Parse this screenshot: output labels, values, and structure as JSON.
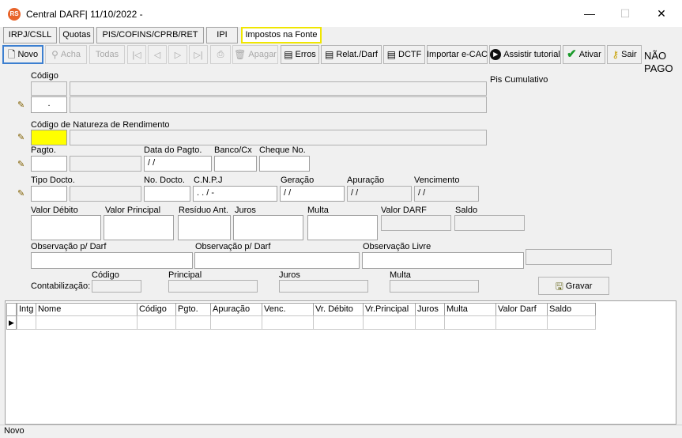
{
  "window": {
    "title": "Central DARF| 11/10/2022 -",
    "app_icon": "RS",
    "minimize": "—",
    "maximize": "☐",
    "close": "✕"
  },
  "tabs": [
    {
      "label": "IRPJ/CSLL"
    },
    {
      "label": "Quotas"
    },
    {
      "label": "PIS/COFINS/CPRB/RET"
    },
    {
      "label": "IPI"
    },
    {
      "label": "Impostos na Fonte",
      "active": true
    }
  ],
  "toolbar": {
    "novo": "Novo",
    "acha": "Acha",
    "todas": "Todas",
    "apagar": "Apagar",
    "erros": "Erros",
    "relat": "Relat./Darf",
    "dctf": "DCTF",
    "importar": "Importar e-CAC",
    "tutorial": "Assistir tutorial",
    "ativar": "Ativar",
    "sair": "Sair",
    "status_line1": "NÃO",
    "status_line2": "PAGO"
  },
  "form": {
    "codigo_label": "Código",
    "codigo_value": ".",
    "pis_cumulativo_label": "Pis Cumulativo",
    "natureza_label": "Código de Natureza de Rendimento",
    "pagto_label": "Pagto.",
    "data_pagto_label": "Data do Pagto.",
    "data_pagto_value": " / /",
    "banco_label": "Banco/Cx",
    "cheque_label": "Cheque No.",
    "tipo_docto_label": "Tipo Docto.",
    "no_docto_label": "No. Docto.",
    "cnpj_label": "C.N.P.J",
    "cnpj_value": " .   .   /    -",
    "geracao_label": "Geração",
    "geracao_value": " / /",
    "apuracao_label": "Apuração",
    "apuracao_value": " / /",
    "vencimento_label": "Vencimento",
    "vencimento_value": " / /",
    "valor_debito_label": "Valor Débito",
    "valor_principal_label": "Valor Principal",
    "residuo_label": "Resíduo Ant.",
    "juros_label": "Juros",
    "multa_label": "Multa",
    "valor_darf_label": "Valor DARF",
    "saldo_label": "Saldo",
    "obs_darf1_label": "Observação p/ Darf",
    "obs_darf2_label": "Observação p/ Darf",
    "obs_livre_label": "Observação Livre",
    "contab_label": "Contabilização:",
    "contab_codigo_label": "Código",
    "contab_principal_label": "Principal",
    "contab_juros_label": "Juros",
    "contab_multa_label": "Multa",
    "gravar": "Gravar"
  },
  "grid": {
    "columns": [
      "Intg",
      "Nome",
      "Código",
      "Pgto.",
      "Apuração",
      "Venc.",
      "Vr. Débito",
      "Vr.Principal",
      "Juros",
      "Multa",
      "Valor Darf",
      "Saldo"
    ]
  },
  "status_bar": {
    "text": "Novo"
  }
}
